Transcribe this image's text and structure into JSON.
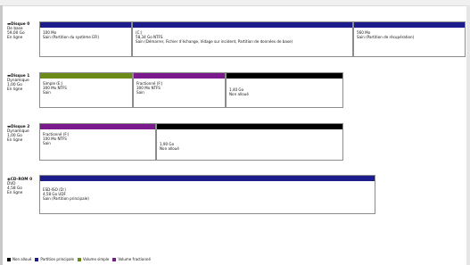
{
  "colors": {
    "primary": "#1c1c8c",
    "logical": "#6b8a1a",
    "extended": "#7a1a8c",
    "unallocated": "#000000"
  },
  "disk0": {
    "title": "Disque 0",
    "type": "De base",
    "size": "59,00 Go",
    "status": "En ligne",
    "p1": {
      "size": "100 Mo",
      "status": "Sain (Partition du système EFI)"
    },
    "p2": {
      "name": "(C:)",
      "size": "58,34 Go NTFS",
      "status": "Sain (Démarrer, Fichier d’échange, Vidage sur incident, Partition de données de base)"
    },
    "p3": {
      "size": "560 Mo",
      "status": "Sain (Partition de récupération)"
    }
  },
  "disk1": {
    "title": "Disque 1",
    "type": "Dynamique",
    "size": "1,00 Go",
    "status": "En ligne",
    "p1": {
      "name": "Simple (E:)",
      "size": "300 Mo NTFS",
      "status": "Sain"
    },
    "p2": {
      "name": "Fractionné (F:)",
      "size": "300 Mo NTFS",
      "status": "Sain"
    },
    "p3": {
      "size": "1,40 Go",
      "status": "Non alloué"
    }
  },
  "disk2": {
    "title": "Disque 2",
    "type": "Dynamique",
    "size": "1,00 Go",
    "status": "En ligne",
    "p1": {
      "name": "Fractionné (F:)",
      "size": "100 Mo NTFS",
      "status": "Sain"
    },
    "p2": {
      "size": "1,90 Go",
      "status": "Non alloué"
    }
  },
  "cdrom": {
    "title": "CD-ROM 0",
    "type": "DVD",
    "size": "4,58 Go",
    "status": "En ligne",
    "p1": {
      "name": "ESD-ISO (D:)",
      "size": "4,58 Go UDF",
      "status": "Sain (Partition principale)"
    }
  },
  "legend": {
    "unallocated": "Non alloué",
    "primary": "Partition principale",
    "simple": "Volume simple",
    "spanned": "Volume fractionné"
  }
}
